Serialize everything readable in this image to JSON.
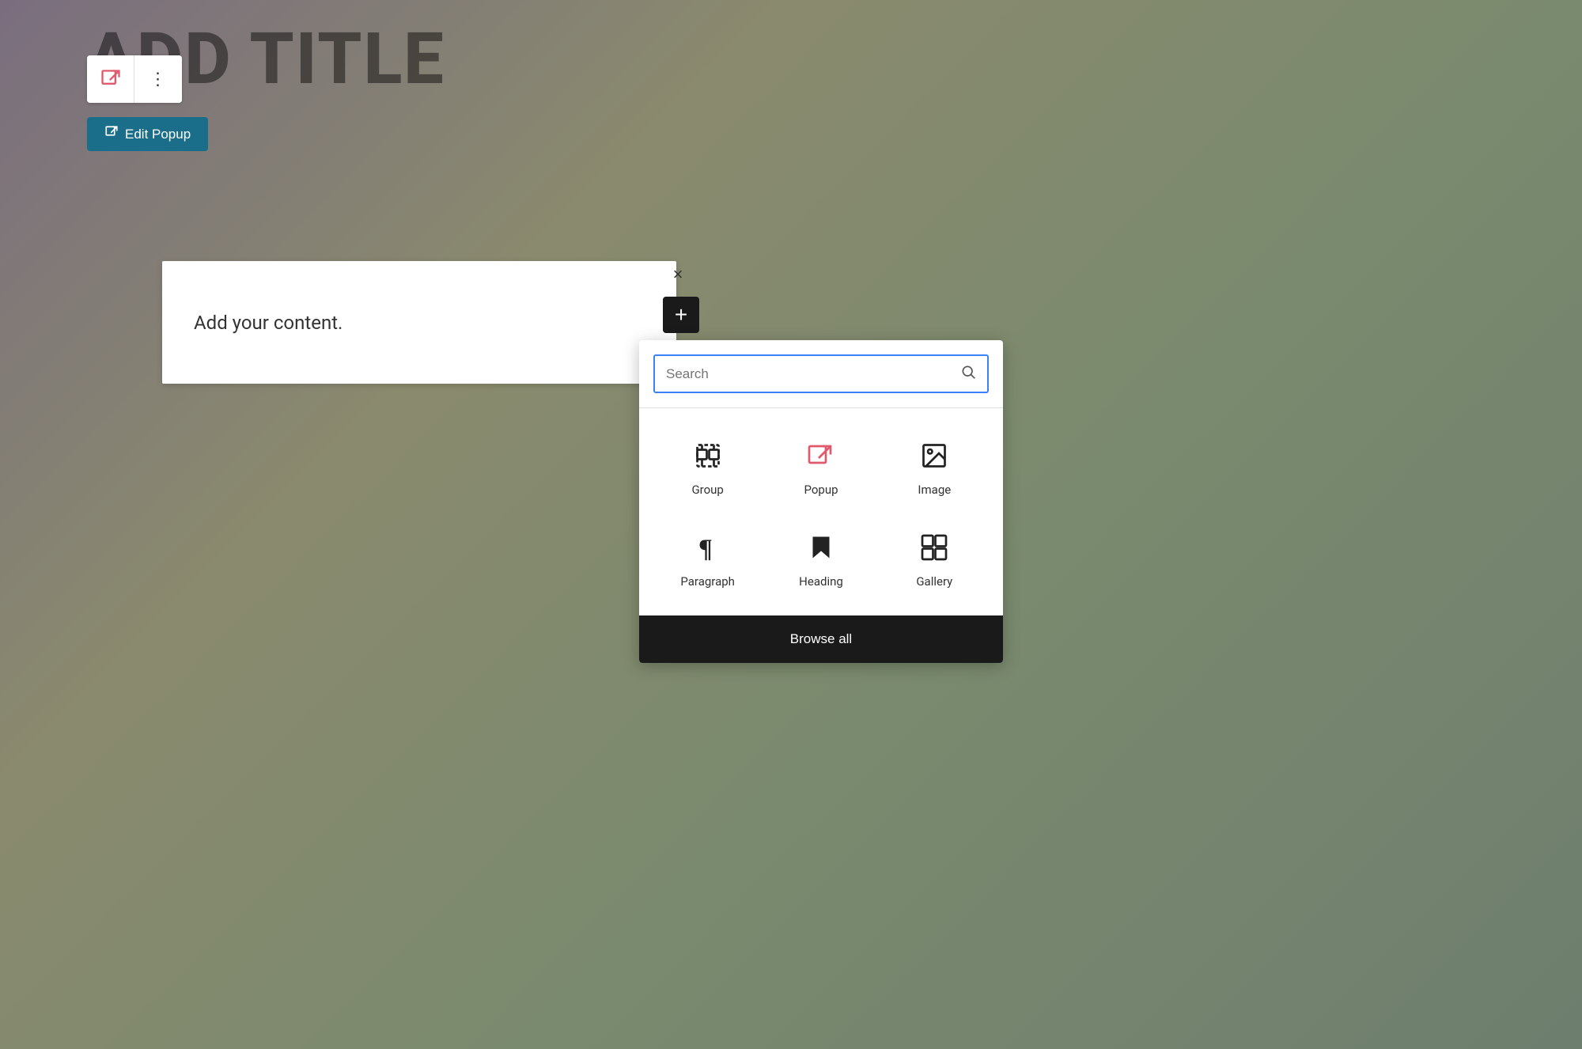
{
  "page": {
    "title": "ADD TITLE",
    "background": "gradient"
  },
  "toolbar": {
    "popup_icon": "⬛",
    "more_options": "⋯"
  },
  "edit_popup_button": {
    "label": "Edit Popup",
    "icon": "↗"
  },
  "content_block": {
    "placeholder": "Add your content."
  },
  "close_button": {
    "label": "×"
  },
  "add_button": {
    "label": "+"
  },
  "inserter": {
    "search_placeholder": "Search",
    "blocks": [
      {
        "id": "group",
        "label": "Group"
      },
      {
        "id": "popup",
        "label": "Popup"
      },
      {
        "id": "image",
        "label": "Image"
      },
      {
        "id": "paragraph",
        "label": "Paragraph"
      },
      {
        "id": "heading",
        "label": "Heading"
      },
      {
        "id": "gallery",
        "label": "Gallery"
      }
    ],
    "browse_all_label": "Browse all"
  }
}
